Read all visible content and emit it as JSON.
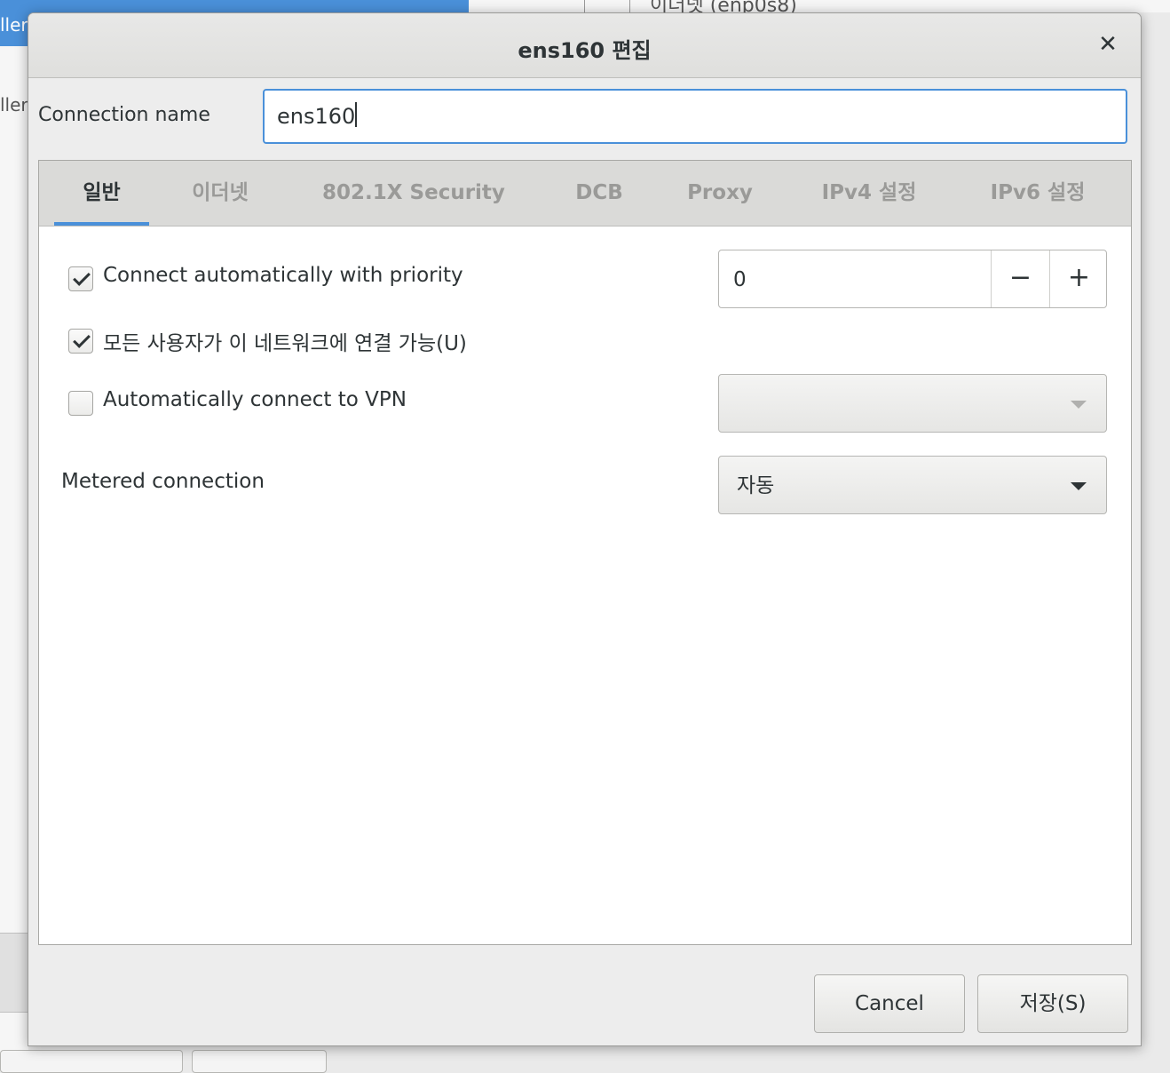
{
  "background": {
    "selected_item_text": "ller",
    "second_item_text": "ller",
    "top_item_text": "이더넷 (enp0s8)"
  },
  "dialog": {
    "title": "ens160 편집",
    "close_icon": "close-icon",
    "connection_name_label": "Connection name",
    "connection_name_value": "ens160",
    "tabs": [
      {
        "label": "일반",
        "active": true
      },
      {
        "label": "이더넷",
        "active": false
      },
      {
        "label": "802.1X Security",
        "active": false
      },
      {
        "label": "DCB",
        "active": false
      },
      {
        "label": "Proxy",
        "active": false
      },
      {
        "label": "IPv4 설정",
        "active": false
      },
      {
        "label": "IPv6 설정",
        "active": false
      }
    ],
    "general": {
      "auto_connect": {
        "label": "Connect automatically with priority",
        "checked": true
      },
      "priority": {
        "value": "0",
        "decrement": "−",
        "increment": "+"
      },
      "all_users": {
        "label": "모든 사용자가 이 네트워크에 연결 가능(U)",
        "checked": true
      },
      "auto_vpn": {
        "label": "Automatically connect to VPN",
        "checked": false,
        "selected": ""
      },
      "metered": {
        "label": "Metered connection",
        "selected": "자동"
      }
    },
    "buttons": {
      "cancel": "Cancel",
      "save": "저장(S)"
    }
  },
  "colors": {
    "accent": "#4a90d9",
    "text": "#2e3436",
    "inactive_tab": "#9a9a98"
  }
}
